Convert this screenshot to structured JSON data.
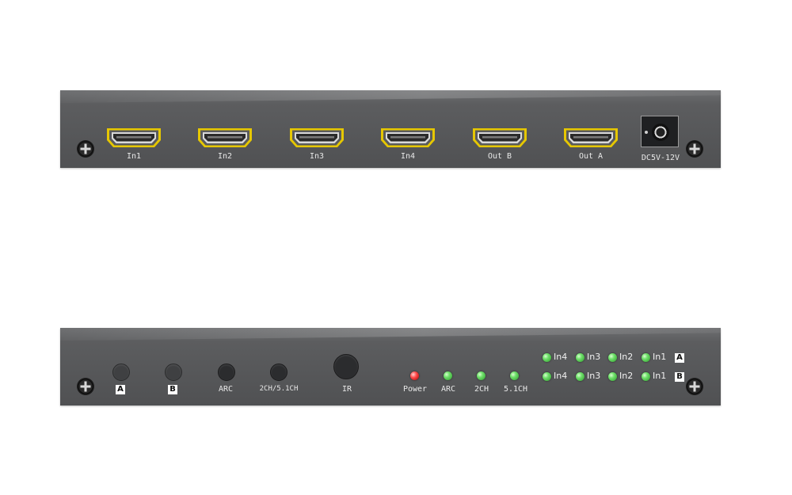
{
  "front_panel": {
    "ports": [
      {
        "label": "In1"
      },
      {
        "label": "In2"
      },
      {
        "label": "In3"
      },
      {
        "label": "In4"
      },
      {
        "label": "Out B"
      },
      {
        "label": "Out A"
      }
    ],
    "power_input_label": "DC5V-12V"
  },
  "back_panel": {
    "buttons": [
      {
        "label": "A"
      },
      {
        "label": "B"
      },
      {
        "label": "ARC"
      },
      {
        "label": "2CH/5.1CH"
      },
      {
        "label": "IR"
      }
    ],
    "status_leds": [
      {
        "label": "Power",
        "color": "#e03030"
      },
      {
        "label": "ARC",
        "color": "#5fd45a"
      },
      {
        "label": "2CH",
        "color": "#5fd45a"
      },
      {
        "label": "5.1CH",
        "color": "#5fd45a"
      }
    ],
    "output_rows": [
      {
        "output": "A",
        "inputs": [
          "In4",
          "In3",
          "In2",
          "In1"
        ]
      },
      {
        "output": "B",
        "inputs": [
          "In4",
          "In3",
          "In2",
          "In1"
        ]
      }
    ]
  },
  "colors": {
    "panel": "#58595b",
    "port_frame": "#e6c700",
    "led_green": "#5fd45a",
    "led_red": "#e03030"
  }
}
